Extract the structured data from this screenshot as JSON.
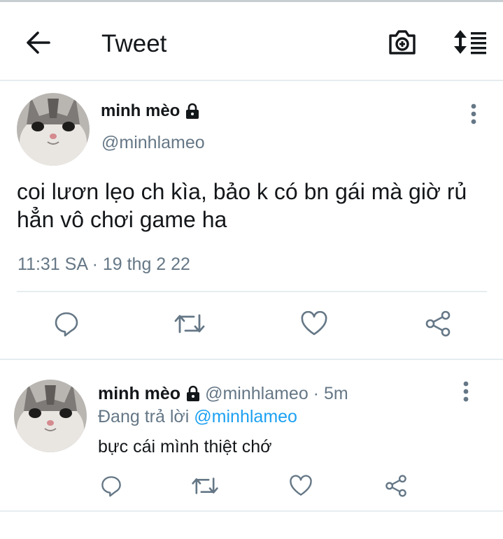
{
  "header": {
    "title": "Tweet",
    "icons": [
      "back-arrow-icon",
      "camera-plus-icon",
      "sort-icon"
    ]
  },
  "tweet": {
    "author_name": "minh mèo",
    "handle": "@minhlameo",
    "text": "coi lươn lẹo ch kìa, bảo k có bn gái mà giờ rủ hẳn vô chơi game ha",
    "timestamp": "11:31 SA · 19 thg 2 22",
    "actions": [
      "reply-icon",
      "retweet-icon",
      "like-icon",
      "share-icon"
    ]
  },
  "reply": {
    "author_name": "minh mèo",
    "handle_time": "@minhlameo · 5m",
    "replying_prefix": "Đang trả lời",
    "replying_to": "@minhlameo",
    "text": "bực cái mình thiệt chớ",
    "actions": [
      "reply-icon",
      "retweet-icon",
      "like-icon",
      "share-icon"
    ]
  },
  "colors": {
    "text_primary": "#14171a",
    "text_secondary": "#657786",
    "link": "#1da1f2",
    "divider": "#e6ecf0"
  }
}
